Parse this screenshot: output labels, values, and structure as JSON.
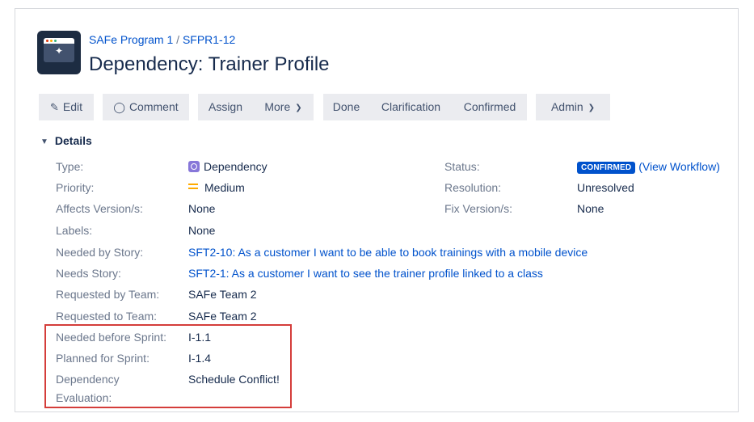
{
  "header": {
    "project_name": "SAFe Program 1",
    "separator": "/",
    "issue_key": "SFPR1-12",
    "title": "Dependency: Trainer Profile"
  },
  "toolbar": {
    "edit_label": "Edit",
    "comment_label": "Comment",
    "assign_label": "Assign",
    "more_label": "More",
    "done_label": "Done",
    "clarification_label": "Clarification",
    "confirmed_label": "Confirmed",
    "admin_label": "Admin"
  },
  "details": {
    "section_label": "Details",
    "type": {
      "label": "Type:",
      "value": "Dependency"
    },
    "priority": {
      "label": "Priority:",
      "value": "Medium"
    },
    "affects_version": {
      "label": "Affects Version/s:",
      "value": "None"
    },
    "labels": {
      "label": "Labels:",
      "value": "None"
    },
    "needed_by_story": {
      "label": "Needed by Story:",
      "value": "SFT2-10: As a customer I want to be able to book trainings with a mobile device"
    },
    "needs_story": {
      "label": "Needs Story:",
      "value": "SFT2-1: As a customer I want to see the trainer profile linked to a class"
    },
    "requested_by_team": {
      "label": "Requested by Team:",
      "value": "SAFe Team 2"
    },
    "requested_to_team": {
      "label": "Requested to Team:",
      "value": "SAFe Team 2"
    },
    "needed_before_sprint": {
      "label": "Needed before Sprint:",
      "value": "I-1.1"
    },
    "planned_for_sprint": {
      "label": "Planned for Sprint:",
      "value": "I-1.4"
    },
    "dependency_evaluation": {
      "label_line1": "Dependency",
      "label_line2": "Evaluation:",
      "value": "Schedule Conflict!"
    },
    "status": {
      "label": "Status:",
      "value": "CONFIRMED",
      "workflow_link": "(View Workflow)"
    },
    "resolution": {
      "label": "Resolution:",
      "value": "Unresolved"
    },
    "fix_version": {
      "label": "Fix Version/s:",
      "value": "None"
    }
  },
  "icons": {
    "project_avatar": "project-avatar-icon",
    "edit": "pencil-icon",
    "comment": "comment-icon",
    "dropdown": "chevron-down-icon",
    "section_toggle": "caret-down-icon",
    "issue_type": "dependency-type-icon",
    "priority": "priority-medium-icon"
  },
  "colors": {
    "link": "#0052cc",
    "status_lozenge": "#0052cc",
    "priority_medium": "#ffab00",
    "issue_type": "#8777d9",
    "highlight_border": "#d43d3a"
  }
}
